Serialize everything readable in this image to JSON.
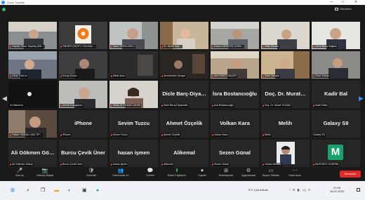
{
  "window": {
    "title": "Zoom Toplantı",
    "min": "—",
    "max": "□",
    "close": "✕"
  },
  "view": {
    "label": "Görünüm"
  },
  "grid": {
    "row1": [
      "Haydar Ömer Saçbüş (MÜ…",
      "ÖNDER-ÇEŞİTLİ YELİHAL…",
      "Sami TOPALOĞLU",
      "Dr. Serife Akp…",
      "Erkan KARAGÖZ (GİSA…",
      "Halis Medan",
      "Umut Barış Sağlam"
    ],
    "row2": [
      "Cihat Yıldırım",
      "Koray Özcan",
      "Nihat Avcu",
      "Şevketullah Çengel",
      "Anıl FIRAT DİNÇER",
      "Şakir Şimşek",
      "Onur Yılmaz"
    ],
    "row3": {
      "captions": [
        "44 İlkimeral",
        "Kemal Karagözen",
        "Selda M.YILMAZ ŞAHİN",
        "Dicle Barış Diyarbakır",
        "İsra Bostancıoğlu",
        "Doç. Dr. Murat YILMAZ",
        "Kadir Balcı"
      ],
      "centers": [
        "",
        "",
        "",
        "Dicle Barç-Diya…",
        "İsra Bostancıoğlu",
        "Doç. Dr. Murat…",
        "Kadir Bal"
      ]
    },
    "row4": {
      "captions": [
        "Hakan YAVAŞLI (MÜ TIP…",
        "iPhone",
        "Sevim Tuzcu",
        "Ahmet Özçelik",
        "Volkan Kara",
        "Melih",
        "Galaxy S9"
      ],
      "centers": [
        "",
        "iPhone",
        "Sevim Tuzcu",
        "Ahmet Özçelik",
        "Volkan Kara",
        "Melih",
        "Galaxy S9"
      ]
    },
    "row5": {
      "captions": [
        "Ali Gökmen Göksu",
        "Burcu Çevik Üner",
        "hasan işmen",
        "Alikemal",
        "Sezen Günal",
        "Volkan AKBAŞ",
        "MUSTAFA YILDIRIM"
      ],
      "centers": [
        "Ali Gökmen Gö…",
        "Burcu Çevik Üner",
        "hasan işmen",
        "Alikemal",
        "Sezen Günal",
        "",
        ""
      ],
      "avatar_letter": "M"
    }
  },
  "toolbar": {
    "items": [
      {
        "icon": "🎤",
        "label": "Sesi aç"
      },
      {
        "icon": "📷",
        "label": "Videoyu Başlat"
      },
      {
        "icon": "🛡",
        "label": "Güvenlik"
      },
      {
        "icon": "👥",
        "label": "Katılımcılar 41"
      },
      {
        "icon": "💬",
        "label": "Sohbet"
      },
      {
        "icon": "⬆",
        "label": "Ekran Paylaşımı"
      },
      {
        "icon": "⏺",
        "label": "Kaydet"
      },
      {
        "icon": "⊞",
        "label": "Reaksiyonlar"
      },
      {
        "icon": "⚙",
        "label": "Uygulamalar"
      },
      {
        "icon": "▭",
        "label": "Beyaz Tahtalar"
      },
      {
        "icon": "⋯",
        "label": "Daha fazla"
      }
    ],
    "end": "Sonlandır"
  },
  "taskbar": {
    "weather": "9°C Çok bulutlu",
    "tray": "^ ⊡ ◧ ◁) Π",
    "time": "21:06",
    "date": "16.01.2023"
  },
  "colors": {
    "accent": "#2d8cff",
    "active_border": "#b6e05a",
    "share_green": "#22c55e",
    "end_red": "#e02828",
    "mic_red": "#ef4444"
  }
}
